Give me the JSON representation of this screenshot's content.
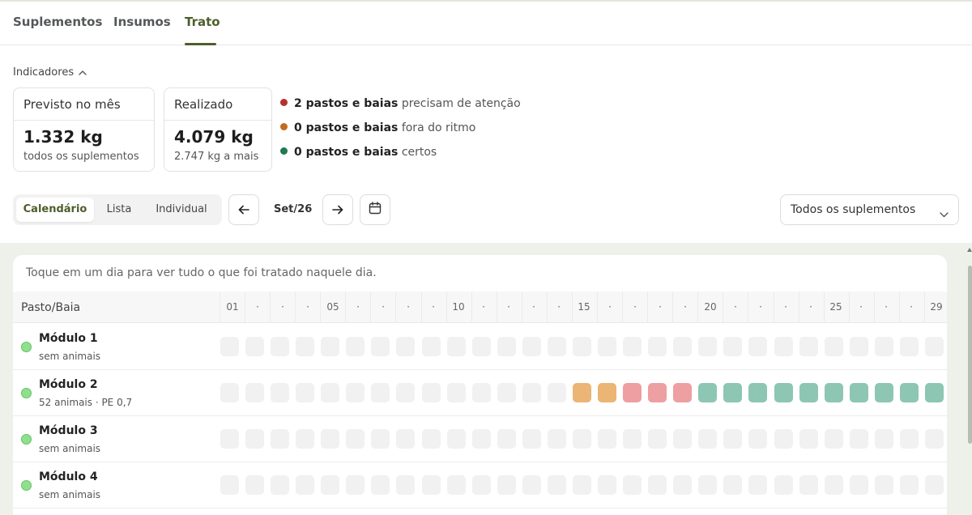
{
  "tabs": [
    {
      "label": "Suplementos",
      "active": false
    },
    {
      "label": "Insumos",
      "active": false
    },
    {
      "label": "Trato",
      "active": true
    }
  ],
  "indicators": {
    "toggle_label": "Indicadores",
    "cards": [
      {
        "title": "Previsto no mês",
        "value": "1.332 kg",
        "subtitle": "todos os suplementos"
      },
      {
        "title": "Realizado",
        "value": "4.079 kg",
        "subtitle": "2.747 kg a mais"
      }
    ],
    "statuses": [
      {
        "bold": "2 pastos e baias",
        "text": "precisam de atenção",
        "color": "#b5322f"
      },
      {
        "bold": "0 pastos e baias",
        "text": "fora do ritmo",
        "color": "#c46a1c"
      },
      {
        "bold": "0 pastos e baias",
        "text": "certos",
        "color": "#1f7a52"
      }
    ]
  },
  "controls": {
    "views": [
      {
        "label": "Calendário",
        "active": true
      },
      {
        "label": "Lista",
        "active": false
      },
      {
        "label": "Individual",
        "active": false
      }
    ],
    "prev_icon": "arrow-left-icon",
    "next_icon": "arrow-right-icon",
    "calendar_icon": "calendar-icon",
    "month": "Set/26",
    "supplement_select": "Todos os suplementos"
  },
  "calendar": {
    "hint": "Toque em um dia para ver tudo o que foi tratado naquele dia.",
    "column_header": "Pasto/Baia",
    "day_labels": [
      "01",
      "·",
      "·",
      "·",
      "05",
      "·",
      "·",
      "·",
      "·",
      "10",
      "·",
      "·",
      "·",
      "·",
      "15",
      "·",
      "·",
      "·",
      "·",
      "20",
      "·",
      "·",
      "·",
      "·",
      "25",
      "·",
      "·",
      "·",
      "29"
    ],
    "status_colors": {
      "empty": "#f1f1f1",
      "ritmo": "#eab575",
      "atencao": "#ee9fa1",
      "certo": "#8dc6b2"
    },
    "rows": [
      {
        "name": "Módulo 1",
        "sub": "sem animais",
        "days": [
          "empty",
          "empty",
          "empty",
          "empty",
          "empty",
          "empty",
          "empty",
          "empty",
          "empty",
          "empty",
          "empty",
          "empty",
          "empty",
          "empty",
          "empty",
          "empty",
          "empty",
          "empty",
          "empty",
          "empty",
          "empty",
          "empty",
          "empty",
          "empty",
          "empty",
          "empty",
          "empty",
          "empty",
          "empty"
        ]
      },
      {
        "name": "Módulo 2",
        "sub": "52 animais · PE 0,7",
        "days": [
          "empty",
          "empty",
          "empty",
          "empty",
          "empty",
          "empty",
          "empty",
          "empty",
          "empty",
          "empty",
          "empty",
          "empty",
          "empty",
          "empty",
          "ritmo",
          "ritmo",
          "atencao",
          "atencao",
          "atencao",
          "certo",
          "certo",
          "certo",
          "certo",
          "certo",
          "certo",
          "certo",
          "certo",
          "certo",
          "certo"
        ]
      },
      {
        "name": "Módulo 3",
        "sub": "sem animais",
        "days": [
          "empty",
          "empty",
          "empty",
          "empty",
          "empty",
          "empty",
          "empty",
          "empty",
          "empty",
          "empty",
          "empty",
          "empty",
          "empty",
          "empty",
          "empty",
          "empty",
          "empty",
          "empty",
          "empty",
          "empty",
          "empty",
          "empty",
          "empty",
          "empty",
          "empty",
          "empty",
          "empty",
          "empty",
          "empty"
        ]
      },
      {
        "name": "Módulo 4",
        "sub": "sem animais",
        "days": [
          "empty",
          "empty",
          "empty",
          "empty",
          "empty",
          "empty",
          "empty",
          "empty",
          "empty",
          "empty",
          "empty",
          "empty",
          "empty",
          "empty",
          "empty",
          "empty",
          "empty",
          "empty",
          "empty",
          "empty",
          "empty",
          "empty",
          "empty",
          "empty",
          "empty",
          "empty",
          "empty",
          "empty",
          "empty"
        ]
      }
    ]
  }
}
